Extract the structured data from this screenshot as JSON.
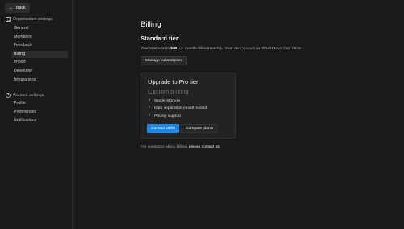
{
  "sidebar": {
    "back_label": "Back",
    "org_section": "Organization settings",
    "org_items": [
      "General",
      "Members",
      "Feedback",
      "Billing",
      "Import",
      "Developer",
      "Integrations"
    ],
    "account_section": "Account settings",
    "account_items": [
      "Profile",
      "Preferences",
      "Notifications"
    ],
    "active_item": "Billing"
  },
  "main": {
    "title": "Billing",
    "tier": "Standard tier",
    "cost_prefix": "Your total cost is ",
    "cost_amount": "$10",
    "cost_suffix": " per month, billed monthly. Your plan renews on 7th of November 2023.",
    "manage_button": "Manage subscription",
    "upgrade_card": {
      "title": "Upgrade to Pro tier",
      "subtitle": "Custom pricing",
      "features": [
        "Single Sign-on",
        "Data separation or self hosted",
        "Priority support"
      ],
      "contact_button": "Contact sales",
      "compare_button": "Compare plans"
    },
    "help_prefix": "For questions about billing, ",
    "help_link": "please contact us"
  },
  "colors": {
    "background": "#1a1a1a",
    "accent": "#1e88e5"
  }
}
